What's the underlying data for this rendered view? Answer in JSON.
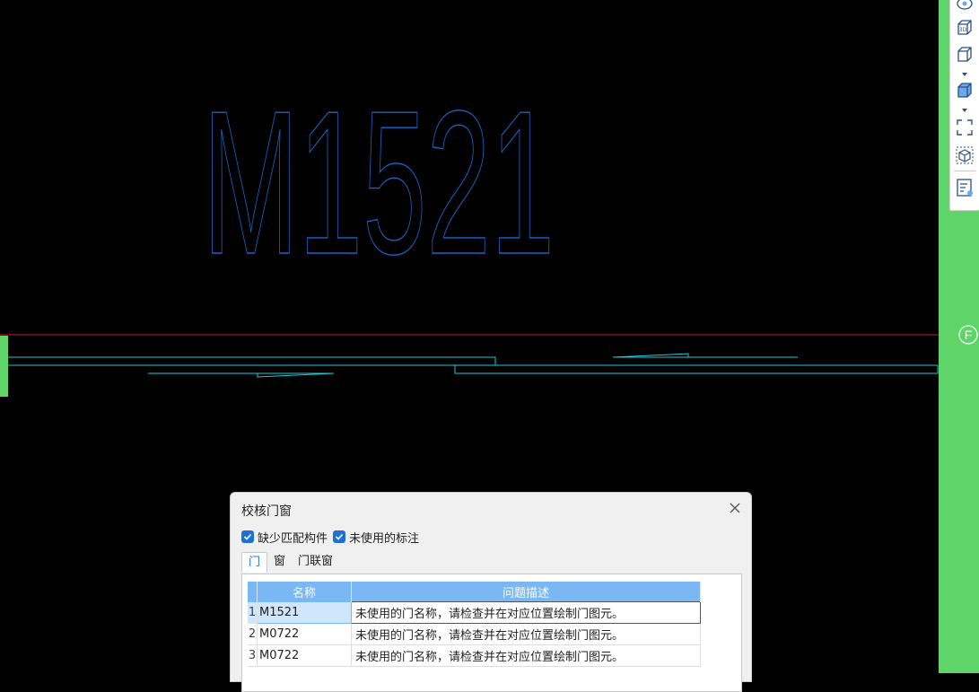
{
  "drawing": {
    "label_text": "M1521",
    "axis_marker_label": "F",
    "colors": {
      "background": "#000000",
      "label_stroke": "#1c64c8",
      "wall_stroke": "#24c8d8",
      "axis_line": "#c82020",
      "axis_strip": "#5fd468"
    }
  },
  "toolbar": {
    "buttons": [
      "3d-rotate-icon",
      "3d-view-icon",
      "box-wireframe-icon",
      "box-solid-icon",
      "zoom-extents-icon",
      "cube-select-icon",
      "properties-panel-icon"
    ]
  },
  "dialog": {
    "title": "校核门窗",
    "checkboxes": [
      {
        "label": "缺少匹配构件",
        "checked": true
      },
      {
        "label": "未使用的标注",
        "checked": true
      }
    ],
    "tabs": [
      {
        "label": "门",
        "active": true
      },
      {
        "label": "窗",
        "active": false
      },
      {
        "label": "门联窗",
        "active": false
      }
    ],
    "table": {
      "headers": [
        "名称",
        "问题描述"
      ],
      "rows": [
        {
          "index": "1",
          "name": "M1521",
          "description": "未使用的门名称，请检查并在对应位置绘制门图元。",
          "selected": true
        },
        {
          "index": "2",
          "name": "M0722",
          "description": "未使用的门名称，请检查并在对应位置绘制门图元。",
          "selected": false
        },
        {
          "index": "3",
          "name": "M0722",
          "description": "未使用的门名称，请检查并在对应位置绘制门图元。",
          "selected": false
        }
      ]
    }
  }
}
